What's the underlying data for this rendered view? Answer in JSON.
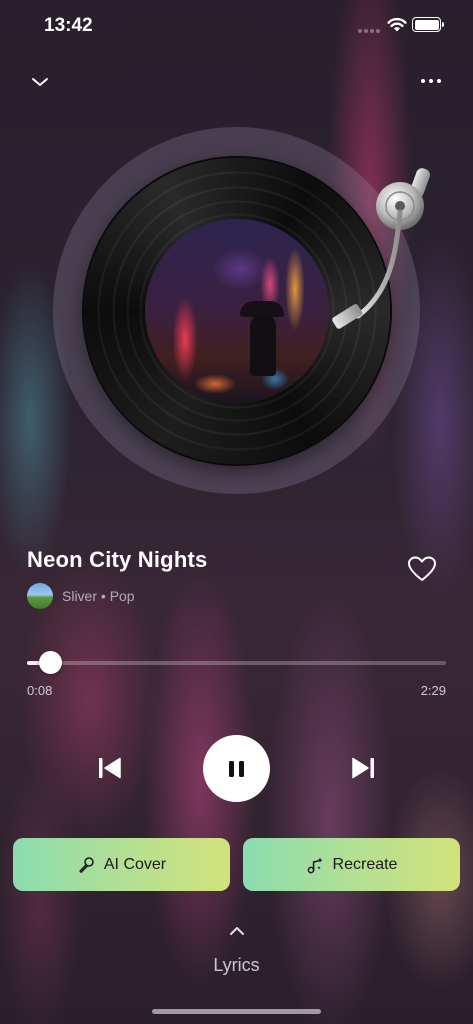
{
  "status_bar": {
    "time": "13:42"
  },
  "track": {
    "title": "Neon City Nights",
    "artist_line": "Sliver • Pop",
    "liked": false
  },
  "progress": {
    "current": "0:08",
    "duration": "2:29",
    "fraction": 0.054
  },
  "player_state": "playing",
  "actions": {
    "ai_cover": "AI Cover",
    "recreate": "Recreate"
  },
  "lyrics_label": "Lyrics",
  "colors": {
    "action_gradient_start": "#8bdcb0",
    "action_gradient_end": "#d2e27a"
  },
  "icons": {
    "collapse": "chevron-down-icon",
    "more": "more-horizontal-icon",
    "like": "heart-icon",
    "previous": "skip-previous-icon",
    "pause": "pause-icon",
    "next": "skip-next-icon",
    "ai_cover": "microphone-icon",
    "recreate": "music-sparkle-icon",
    "lyrics_expand": "chevron-up-icon"
  }
}
